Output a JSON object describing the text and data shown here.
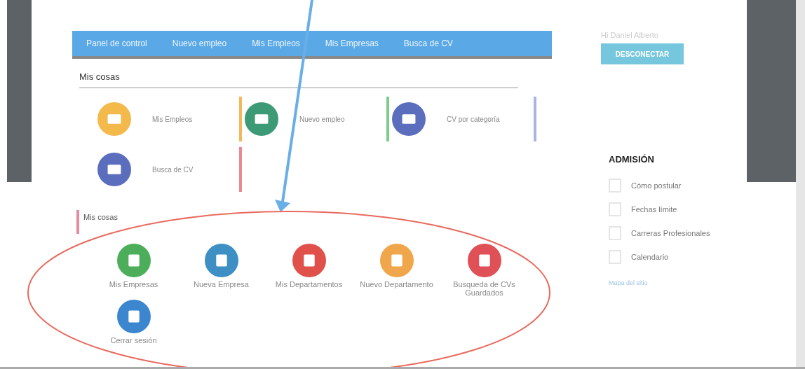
{
  "nav": [
    {
      "label": "Panel de control"
    },
    {
      "label": "Nuevo empleo"
    },
    {
      "label": "Mis Empleos"
    },
    {
      "label": "Mis Empresas"
    },
    {
      "label": "Busca de CV"
    }
  ],
  "user": {
    "greeting": "Hi Daniel Alberto",
    "logout_button": "DESCONECTAR"
  },
  "section_1": {
    "title": "Mis cosas",
    "tiles": [
      {
        "label": "Mis Empleos",
        "color": "#f3b94a"
      },
      {
        "label": "Nuevo empleo",
        "color": "#3d9a76"
      },
      {
        "label": "CV por categoría",
        "color": "#5b6dbd"
      },
      {
        "label": "Busca de CV",
        "color": "#5b6dbd"
      }
    ],
    "dividers": [
      {
        "color": "#f5b75a"
      },
      {
        "color": "#7dcc8a"
      },
      {
        "color": "#a9b4e6"
      },
      {
        "color": "#e88a8f"
      }
    ]
  },
  "section_2": {
    "title": "Mis cosas",
    "tiles": [
      {
        "label": "Mis Empresas",
        "color": "#4cae5b"
      },
      {
        "label": "Nueva Empresa",
        "color": "#3d8fc4"
      },
      {
        "label": "Mis Departamentos",
        "color": "#e0514c"
      },
      {
        "label": "Nuevo Departamento",
        "color": "#f0a64a"
      },
      {
        "label": "Busqueda de CVs Guardados",
        "color": "#df5156"
      },
      {
        "label": "Cerrar sesión",
        "color": "#3b86cf"
      }
    ]
  },
  "sidebar": {
    "title": "ADMISIÓN",
    "items": [
      {
        "label": "Cómo postular"
      },
      {
        "label": "Fechas límite"
      },
      {
        "label": "Carreras Profesionales"
      },
      {
        "label": "Calendario"
      }
    ],
    "link": "Mapa del sitio"
  }
}
